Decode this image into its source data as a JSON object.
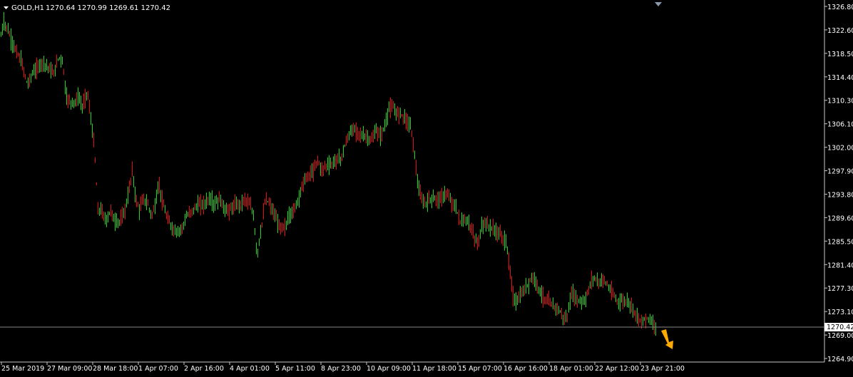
{
  "header": {
    "symbol": "GOLD,H1",
    "ohlc": "1270.64 1270.99 1269.61 1270.42"
  },
  "chart_data": {
    "type": "candlestick",
    "symbol": "GOLD",
    "timeframe": "H1",
    "ylim": [
      1264.9,
      1326.8
    ],
    "y_ticks": [
      "1326.80",
      "1322.60",
      "1318.50",
      "1314.40",
      "1310.30",
      "1306.10",
      "1302.00",
      "1297.90",
      "1293.80",
      "1289.60",
      "1285.50",
      "1281.40",
      "1277.30",
      "1273.10",
      "1269.00",
      "1264.90"
    ],
    "x_ticks": [
      "25 Mar 2019",
      "27 Mar 09:00",
      "28 Mar 18:00",
      "1 Apr 07:00",
      "2 Apr 16:00",
      "4 Apr 01:00",
      "5 Apr 11:00",
      "8 Apr 23:00",
      "10 Apr 09:00",
      "11 Apr 18:00",
      "15 Apr 07:00",
      "16 Apr 16:00",
      "18 Apr 01:00",
      "22 Apr 12:00",
      "23 Apr 21:00"
    ],
    "current_price": "1270.42",
    "price_path": [
      [
        0,
        1321
      ],
      [
        5,
        1324
      ],
      [
        10,
        1323
      ],
      [
        15,
        1321
      ],
      [
        22,
        1319
      ],
      [
        30,
        1317
      ],
      [
        38,
        1313
      ],
      [
        45,
        1315
      ],
      [
        52,
        1316
      ],
      [
        60,
        1317
      ],
      [
        68,
        1316
      ],
      [
        75,
        1315
      ],
      [
        82,
        1318
      ],
      [
        88,
        1317
      ],
      [
        92,
        1311
      ],
      [
        98,
        1310
      ],
      [
        105,
        1310
      ],
      [
        110,
        1311
      ],
      [
        115,
        1309
      ],
      [
        122,
        1312
      ],
      [
        127,
        1307
      ],
      [
        132,
        1302
      ],
      [
        137,
        1291
      ],
      [
        142,
        1291
      ],
      [
        148,
        1289
      ],
      [
        155,
        1291
      ],
      [
        160,
        1289
      ],
      [
        168,
        1289
      ],
      [
        175,
        1291
      ],
      [
        180,
        1294
      ],
      [
        185,
        1298
      ],
      [
        190,
        1293
      ],
      [
        195,
        1291
      ],
      [
        200,
        1293
      ],
      [
        207,
        1292
      ],
      [
        212,
        1290
      ],
      [
        218,
        1292
      ],
      [
        222,
        1296
      ],
      [
        228,
        1292
      ],
      [
        233,
        1290
      ],
      [
        240,
        1288
      ],
      [
        248,
        1287
      ],
      [
        255,
        1288
      ],
      [
        262,
        1290
      ],
      [
        270,
        1291
      ],
      [
        278,
        1292
      ],
      [
        285,
        1292
      ],
      [
        293,
        1293
      ],
      [
        300,
        1292
      ],
      [
        308,
        1293
      ],
      [
        315,
        1291
      ],
      [
        322,
        1291
      ],
      [
        330,
        1292
      ],
      [
        337,
        1292
      ],
      [
        343,
        1293
      ],
      [
        350,
        1292
      ],
      [
        355,
        1290
      ],
      [
        360,
        1283
      ],
      [
        365,
        1287
      ],
      [
        372,
        1293
      ],
      [
        378,
        1292
      ],
      [
        385,
        1290
      ],
      [
        392,
        1288
      ],
      [
        400,
        1288
      ],
      [
        405,
        1290
      ],
      [
        412,
        1291
      ],
      [
        418,
        1293
      ],
      [
        425,
        1296
      ],
      [
        432,
        1297
      ],
      [
        440,
        1298
      ],
      [
        445,
        1300
      ],
      [
        450,
        1298
      ],
      [
        458,
        1299
      ],
      [
        465,
        1299
      ],
      [
        472,
        1300
      ],
      [
        478,
        1300
      ],
      [
        485,
        1303
      ],
      [
        492,
        1305
      ],
      [
        500,
        1305
      ],
      [
        507,
        1304
      ],
      [
        513,
        1304
      ],
      [
        520,
        1303
      ],
      [
        527,
        1305
      ],
      [
        533,
        1304
      ],
      [
        540,
        1306
      ],
      [
        545,
        1309
      ],
      [
        550,
        1309
      ],
      [
        556,
        1308
      ],
      [
        562,
        1308
      ],
      [
        568,
        1307
      ],
      [
        575,
        1306
      ],
      [
        580,
        1302
      ],
      [
        585,
        1296
      ],
      [
        590,
        1293
      ],
      [
        596,
        1292
      ],
      [
        602,
        1293
      ],
      [
        610,
        1293
      ],
      [
        618,
        1293
      ],
      [
        625,
        1294
      ],
      [
        630,
        1293
      ],
      [
        635,
        1292
      ],
      [
        640,
        1291
      ],
      [
        645,
        1289
      ],
      [
        650,
        1289
      ],
      [
        655,
        1289
      ],
      [
        660,
        1288
      ],
      [
        665,
        1286
      ],
      [
        670,
        1285
      ],
      [
        675,
        1288
      ],
      [
        680,
        1289
      ],
      [
        685,
        1288
      ],
      [
        690,
        1288
      ],
      [
        695,
        1287
      ],
      [
        700,
        1287
      ],
      [
        705,
        1286
      ],
      [
        710,
        1285
      ],
      [
        715,
        1280
      ],
      [
        720,
        1275
      ],
      [
        725,
        1275
      ],
      [
        730,
        1276
      ],
      [
        735,
        1277
      ],
      [
        740,
        1278
      ],
      [
        745,
        1279
      ],
      [
        750,
        1279
      ],
      [
        755,
        1277
      ],
      [
        760,
        1276
      ],
      [
        765,
        1275
      ],
      [
        770,
        1275
      ],
      [
        775,
        1274
      ],
      [
        780,
        1274
      ],
      [
        785,
        1273
      ],
      [
        790,
        1272
      ],
      [
        795,
        1272
      ],
      [
        800,
        1276
      ],
      [
        805,
        1276
      ],
      [
        810,
        1275
      ],
      [
        815,
        1275
      ],
      [
        820,
        1275
      ],
      [
        825,
        1277
      ],
      [
        830,
        1279
      ],
      [
        835,
        1279
      ],
      [
        840,
        1278
      ],
      [
        845,
        1279
      ],
      [
        850,
        1278
      ],
      [
        855,
        1277
      ],
      [
        860,
        1276
      ],
      [
        865,
        1275
      ],
      [
        870,
        1275
      ],
      [
        875,
        1275
      ],
      [
        880,
        1275
      ],
      [
        885,
        1274
      ],
      [
        890,
        1273
      ],
      [
        895,
        1272
      ],
      [
        900,
        1271
      ],
      [
        905,
        1272
      ],
      [
        910,
        1272
      ],
      [
        915,
        1271
      ],
      [
        920,
        1270.42
      ]
    ]
  }
}
